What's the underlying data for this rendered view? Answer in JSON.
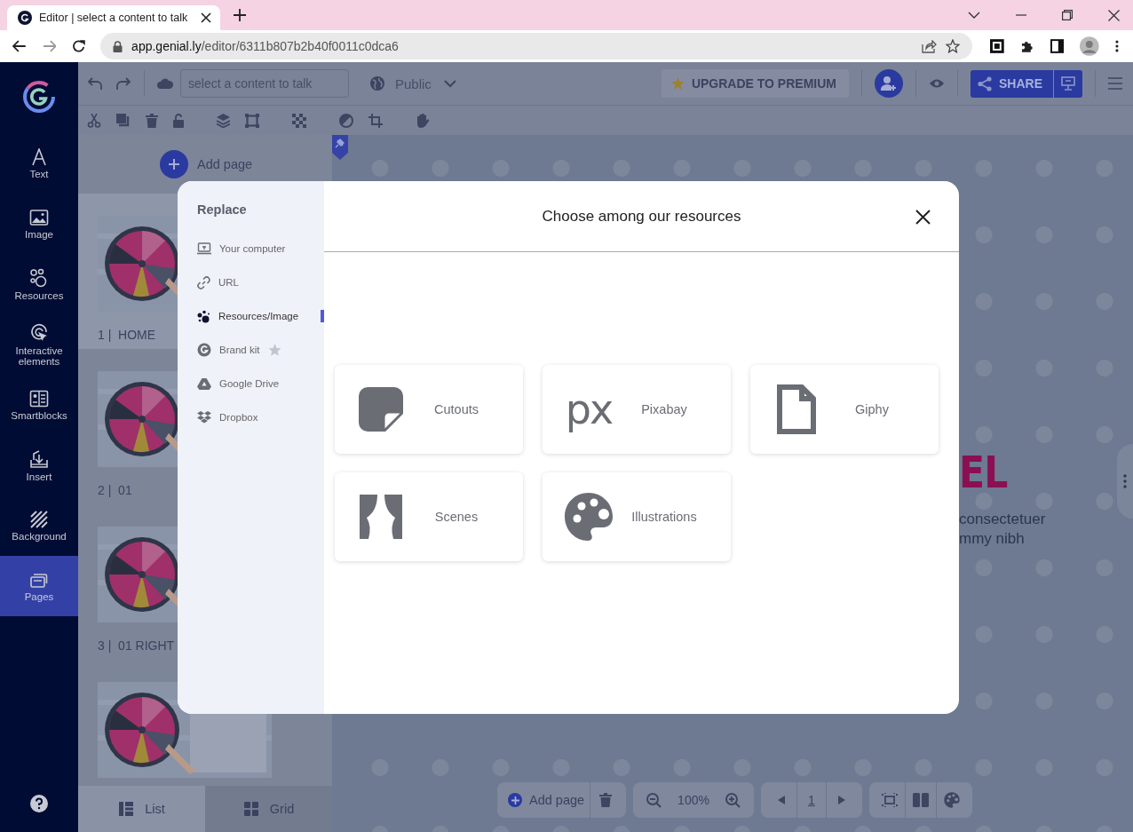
{
  "browser": {
    "tab_title": "Editor | select a content to talk",
    "url_host": "app.genial.ly",
    "url_path": "/editor/6311b807b2b40f0011c0dca6"
  },
  "nav": [
    {
      "label": "Text",
      "selected": false
    },
    {
      "label": "Image",
      "selected": false
    },
    {
      "label": "Resources",
      "selected": false
    },
    {
      "label": "Interactive elements",
      "selected": false
    },
    {
      "label": "Smartblocks",
      "selected": false
    },
    {
      "label": "Insert",
      "selected": false
    },
    {
      "label": "Background",
      "selected": false
    },
    {
      "label": "Pages",
      "selected": true
    }
  ],
  "toolbar": {
    "title_placeholder": "select a content to talk",
    "visibility": "Public",
    "upgrade": "UPGRADE TO PREMIUM",
    "share": "SHARE"
  },
  "pages_panel": {
    "add_page": "Add page",
    "pages": [
      {
        "label": "1 |  HOME",
        "selected": true
      },
      {
        "label": "2 |  01",
        "selected": false
      },
      {
        "label": "3 |  01 RIGHT",
        "selected": false
      },
      {
        "selected": false
      }
    ],
    "view_tabs": [
      {
        "label": "List",
        "selected": true
      },
      {
        "label": "Grid",
        "selected": false
      }
    ]
  },
  "canvas": {
    "title": "EL",
    "body_lines": [
      "consectetuer",
      "mmy nibh"
    ]
  },
  "bottom_bar": {
    "add_page": "Add page",
    "zoom": "100%",
    "page": "1"
  },
  "modal": {
    "menu_title": "Replace",
    "menu": [
      {
        "label": "Your computer",
        "selected": false,
        "premium": false
      },
      {
        "label": "URL",
        "selected": false,
        "premium": false
      },
      {
        "label": "Resources/Image",
        "selected": true,
        "premium": false
      },
      {
        "label": "Brand kit",
        "selected": false,
        "premium": true
      },
      {
        "label": "Google Drive",
        "selected": false,
        "premium": false
      },
      {
        "label": "Dropbox",
        "selected": false,
        "premium": false
      }
    ],
    "title": "Choose among our resources",
    "sources": [
      {
        "label": "Cutouts"
      },
      {
        "label": "Pixabay",
        "logo_text": "px"
      },
      {
        "label": "Giphy"
      },
      {
        "label": "Scenes"
      },
      {
        "label": "Illustrations"
      }
    ]
  }
}
